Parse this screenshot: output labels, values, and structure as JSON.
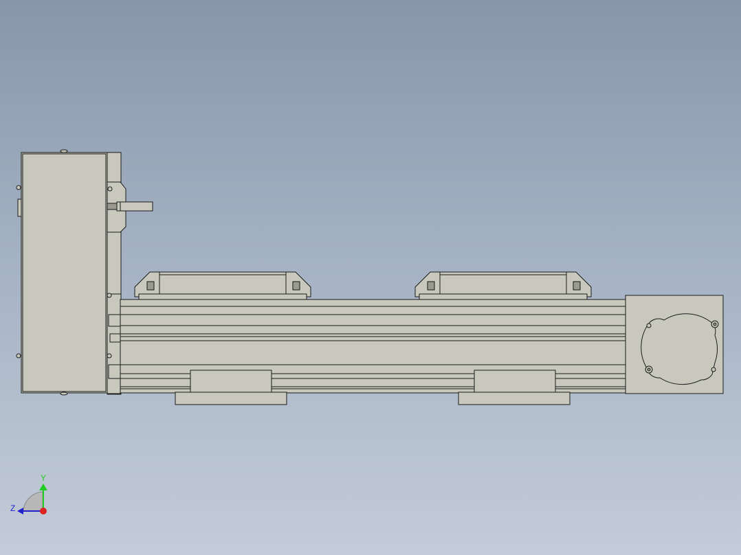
{
  "viewport": {
    "background_top": "#8796aa",
    "background_bottom": "#c3ccd8"
  },
  "model": {
    "part_color": "#c8c8bc",
    "edge_color": "#1a1a1a"
  },
  "triad": {
    "y_label": "Y",
    "z_label": "Z",
    "y_color": "#22cc22",
    "z_color": "#2222cc",
    "x_color": "#dd2222"
  }
}
